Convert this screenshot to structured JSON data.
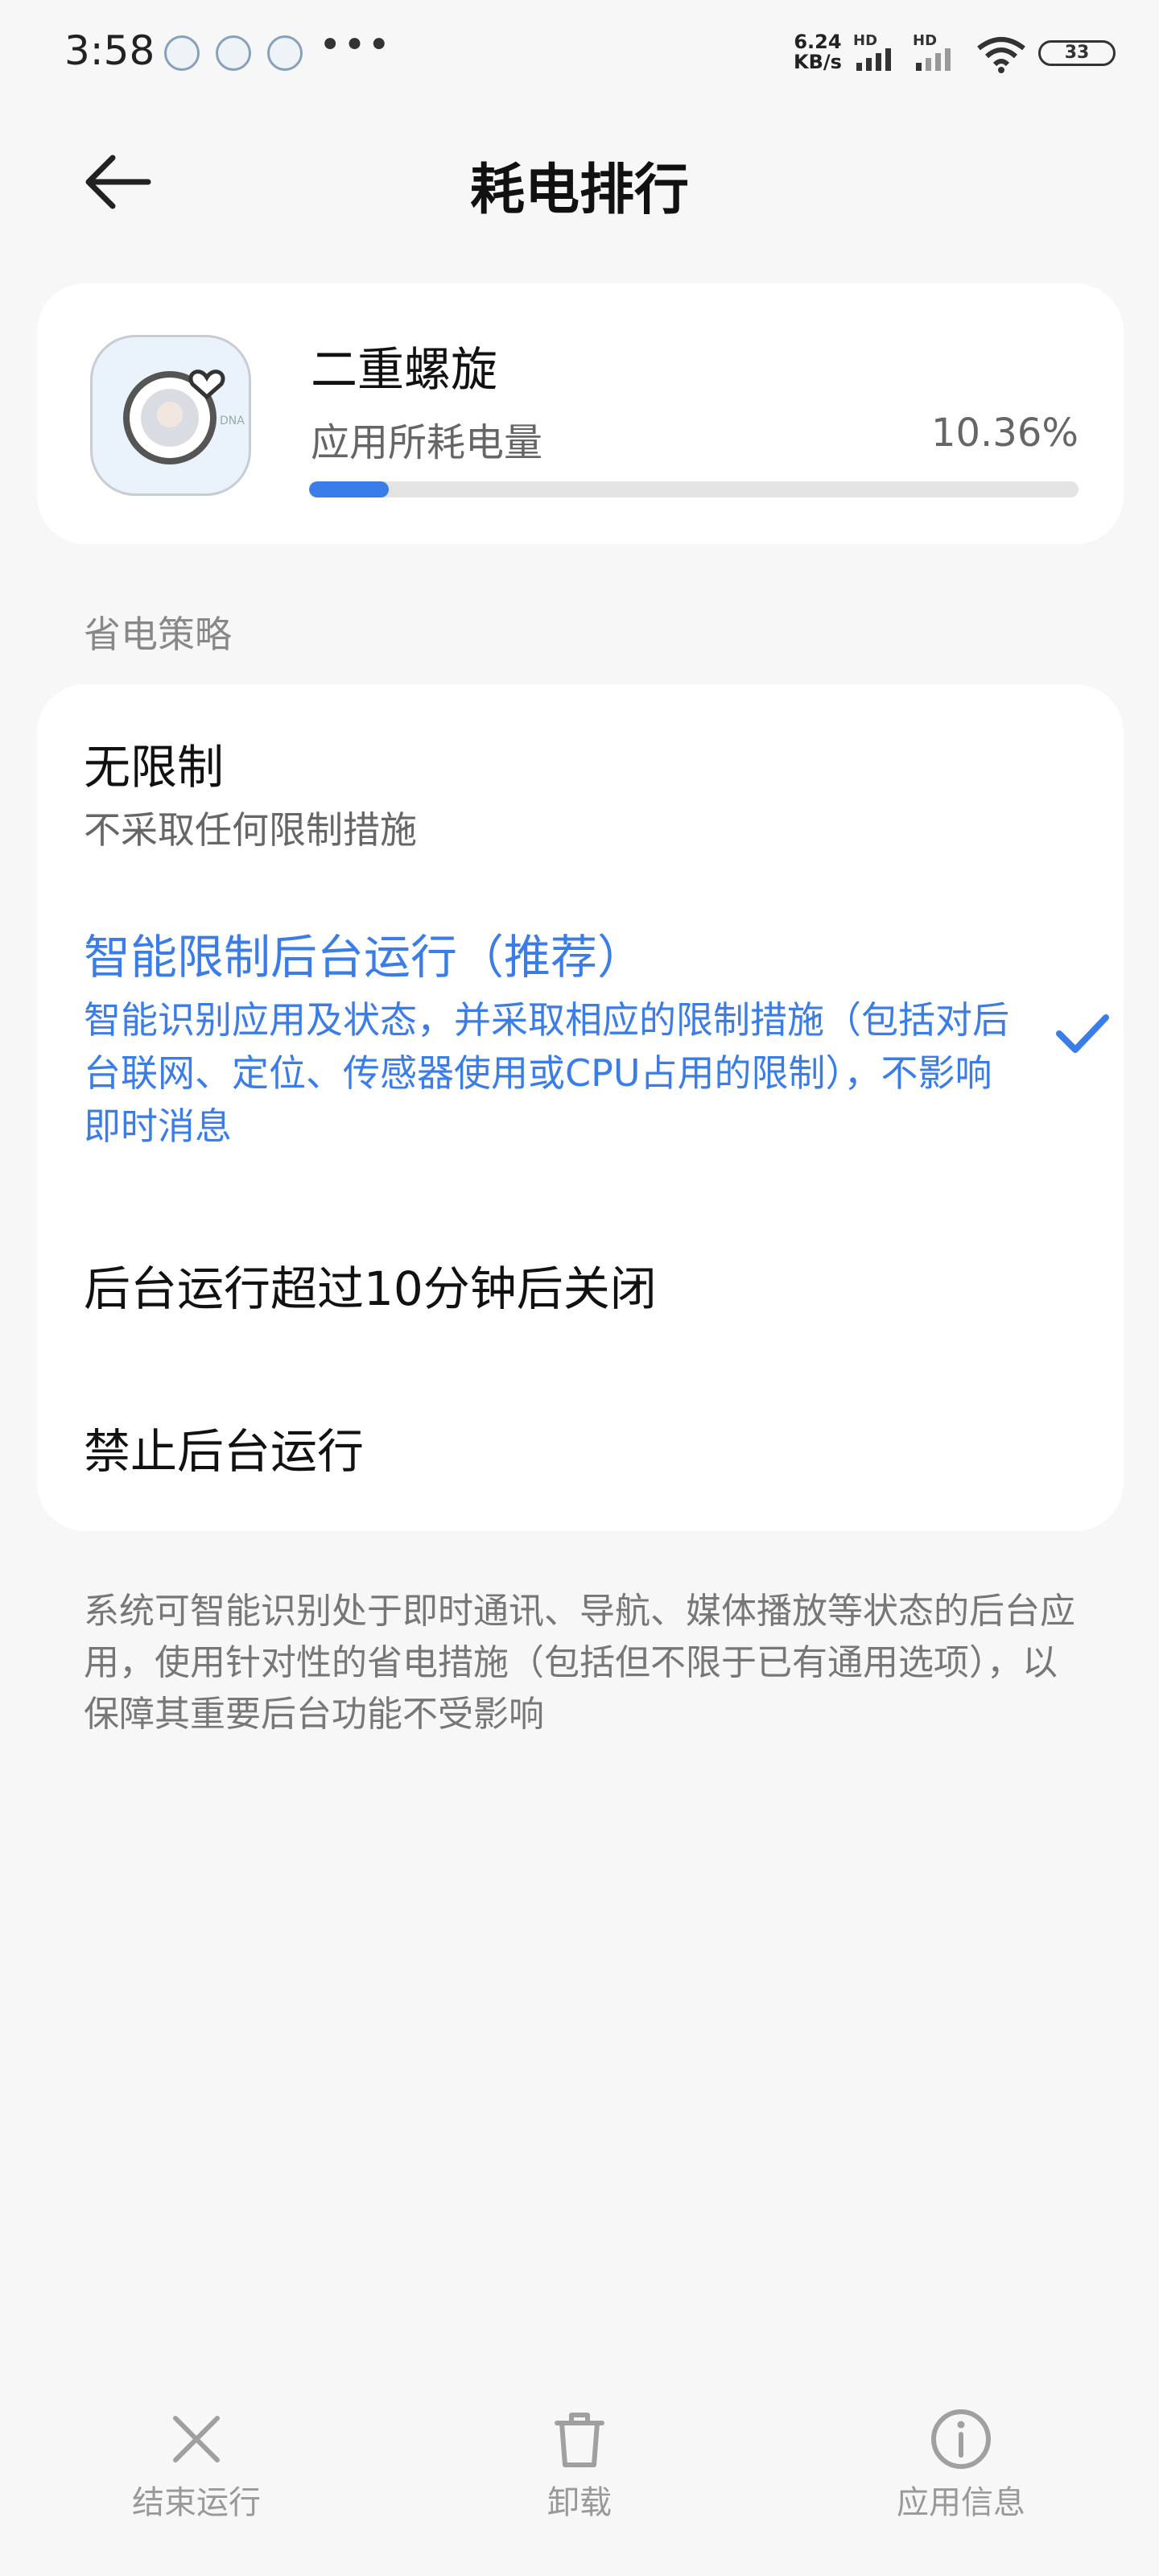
{
  "status_bar": {
    "time": "3:58",
    "more": "•••",
    "net_speed_value": "6.24",
    "net_speed_unit": "KB/s",
    "hd1": "HD",
    "hd2": "HD",
    "battery": "33"
  },
  "header": {
    "title": "耗电排行",
    "back_icon": "arrow-left-icon"
  },
  "app": {
    "name": "二重螺旋",
    "usage_label": "应用所耗电量",
    "usage_percent": "10.36%",
    "usage_fraction": 0.1036,
    "bar_color": "#3b7de8"
  },
  "section": {
    "label": "省电策略"
  },
  "options": [
    {
      "title": "无限制",
      "desc": "不采取任何限制措施",
      "selected": false
    },
    {
      "title": "智能限制后台运行（推荐）",
      "desc": "智能识别应用及状态，并采取相应的限制措施（包括对后台联网、定位、传感器使用或CPU占用的限制），不影响即时消息",
      "selected": true
    },
    {
      "title": "后台运行超过10分钟后关闭",
      "desc": "",
      "selected": false
    },
    {
      "title": "禁止后台运行",
      "desc": "",
      "selected": false
    }
  ],
  "footnote": "系统可智能识别处于即时通讯、导航、媒体播放等状态的后台应用，使用针对性的省电措施（包括但不限于已有通用选项），以保障其重要后台功能不受影响",
  "bottom_bar": {
    "stop": {
      "label": "结束运行",
      "icon": "close-icon"
    },
    "uninstall": {
      "label": "卸载",
      "icon": "trash-icon"
    },
    "info": {
      "label": "应用信息",
      "icon": "info-icon"
    }
  },
  "colors": {
    "accent": "#3b7de8",
    "background": "#f7f7f7"
  }
}
